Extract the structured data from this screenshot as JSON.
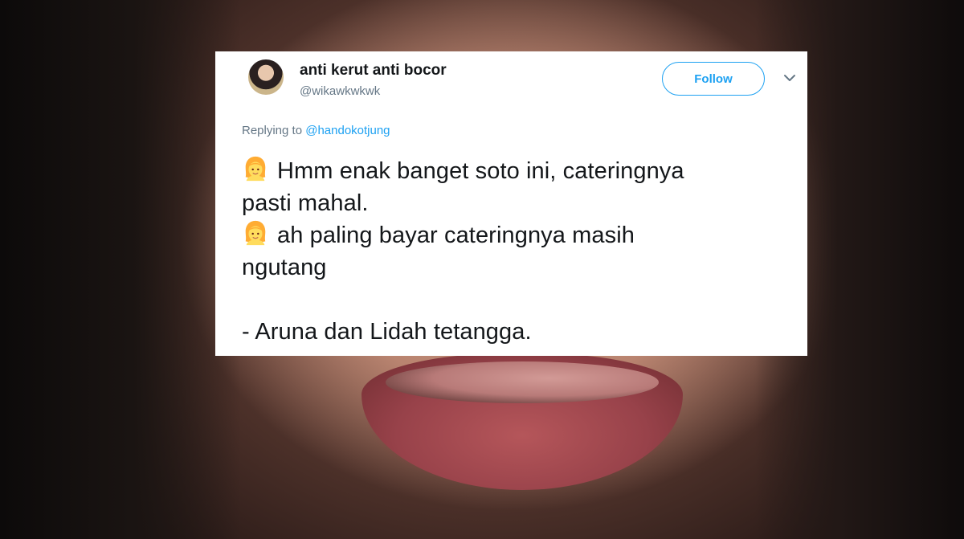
{
  "tweet": {
    "author_name": "anti kerut anti bocor",
    "author_handle": "@wikawkwkwk",
    "follow_label": "Follow",
    "reply_prefix": "Replying to",
    "reply_target": "@handokotjung",
    "lines": [
      "Hmm enak banget soto ini, cateringnya",
      "pasti mahal.",
      "ah paling bayar cateringnya masih",
      "ngutang",
      "- Aruna dan Lidah tetangga."
    ],
    "emoji_icons": [
      "person-blond-hair-emoji-icon",
      "person-blond-hair-emoji-icon"
    ]
  },
  "colors": {
    "accent": "#1da1f2",
    "text": "#14171a",
    "secondary": "#657786"
  }
}
